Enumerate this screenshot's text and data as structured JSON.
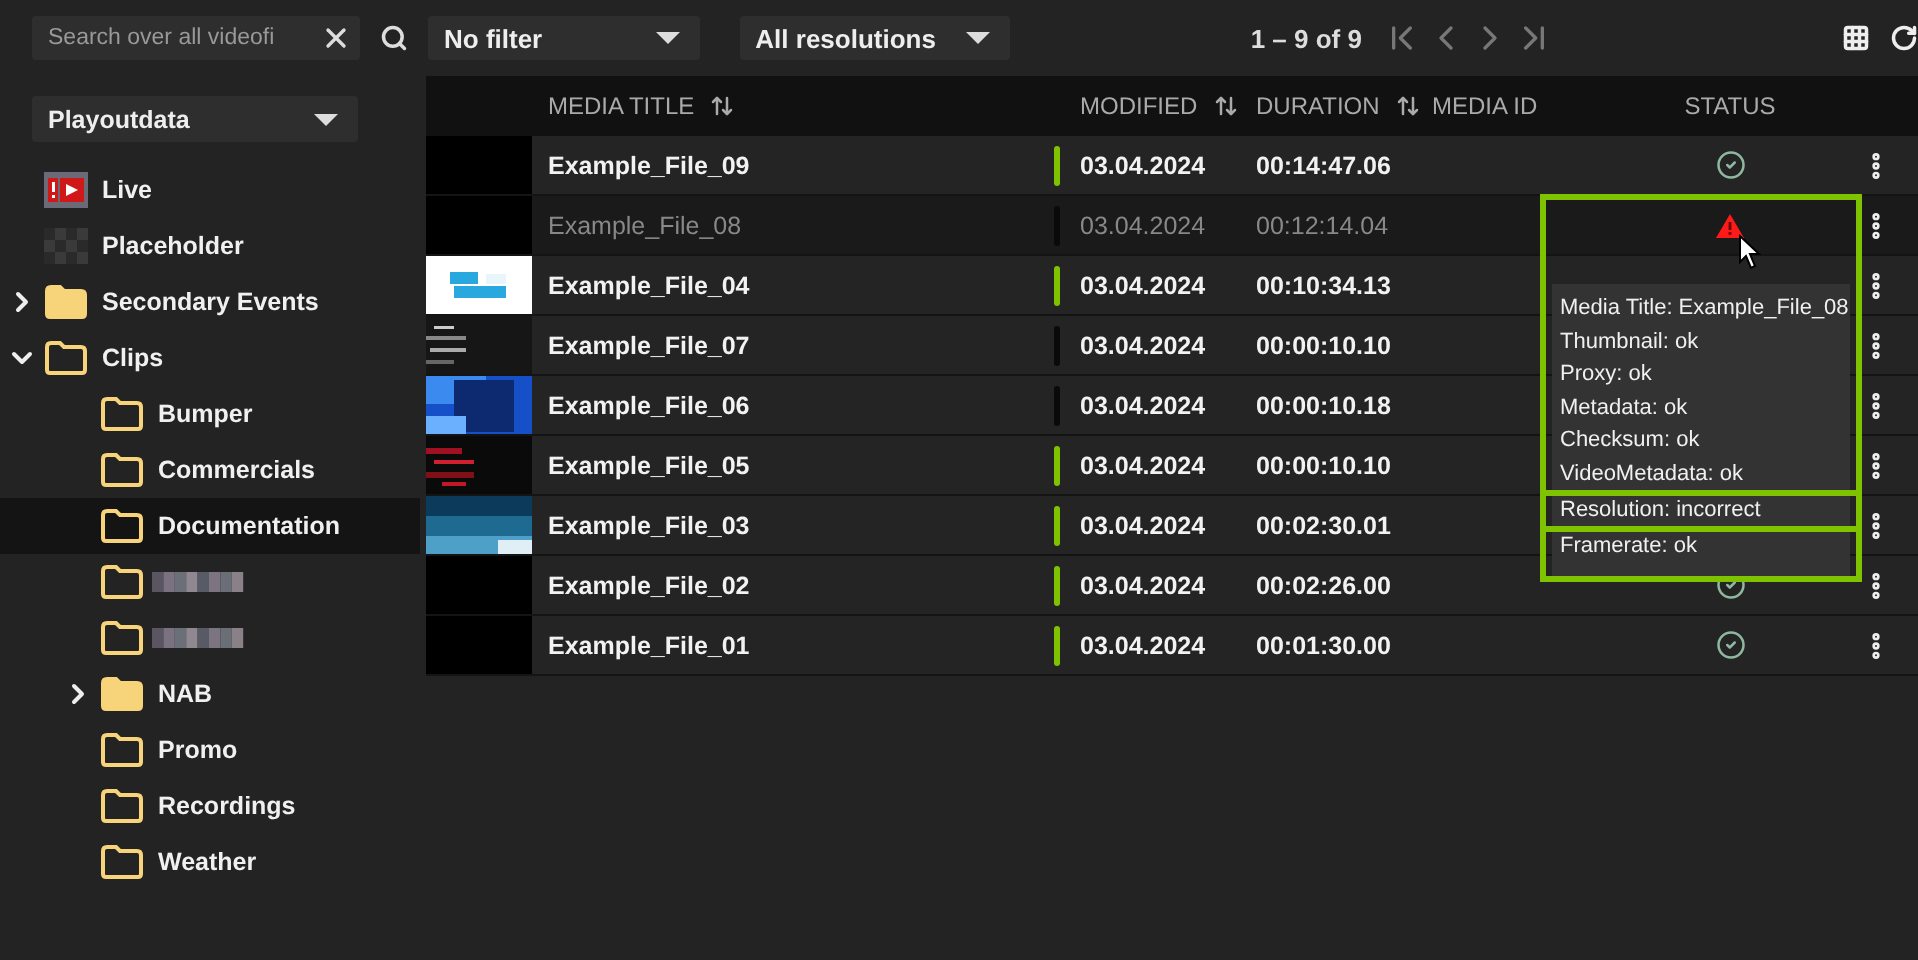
{
  "toolbar": {
    "search": {
      "placeholder": "Search over all videofi"
    },
    "filters": [
      {
        "value": "No filter"
      },
      {
        "value": "All resolutions"
      }
    ],
    "pager": {
      "range": "1 – 9 of 9"
    }
  },
  "sidebar": {
    "source": {
      "value": "Playoutdata"
    },
    "items": [
      {
        "kind": "live",
        "label": "Live",
        "selected": false
      },
      {
        "kind": "placeholder",
        "label": "Placeholder",
        "selected": false
      },
      {
        "kind": "folder",
        "label": "Secondary Events",
        "expanded": false,
        "selected": false
      },
      {
        "kind": "folder",
        "label": "Clips",
        "expanded": true,
        "selected": false,
        "children": [
          {
            "kind": "folder",
            "label": "Bumper",
            "selected": false
          },
          {
            "kind": "folder",
            "label": "Commercials",
            "selected": false
          },
          {
            "kind": "folder",
            "label": "Documentation",
            "selected": true
          },
          {
            "kind": "redacted",
            "selected": false
          },
          {
            "kind": "redacted",
            "selected": false
          },
          {
            "kind": "folder",
            "label": "NAB",
            "expanded": false,
            "selected": false
          },
          {
            "kind": "folder",
            "label": "Promo",
            "selected": false
          },
          {
            "kind": "folder",
            "label": "Recordings",
            "selected": false
          },
          {
            "kind": "folder",
            "label": "Weather",
            "selected": false
          }
        ]
      }
    ]
  },
  "table": {
    "columns": [
      {
        "label": "MEDIA TITLE",
        "sortable": true
      },
      {
        "label": "MODIFIED",
        "sortable": true
      },
      {
        "label": "DURATION",
        "sortable": true
      },
      {
        "label": "MEDIA ID",
        "sortable": false
      },
      {
        "label": "STATUS",
        "sortable": false
      }
    ],
    "rows": [
      {
        "thumbnail": {
          "kind": "blank"
        },
        "title": "Example_File_09",
        "ready": true,
        "disabled": false,
        "modified": "03.04.2024",
        "duration": "00:14:47.06",
        "status": {
          "kind": "ok"
        }
      },
      {
        "thumbnail": {
          "kind": "blank"
        },
        "title": "Example_File_08",
        "ready": false,
        "disabled": true,
        "modified": "03.04.2024",
        "duration": "00:12:14.04",
        "status": {
          "kind": "warning"
        }
      },
      {
        "title": "Example_File_04",
        "ready": true,
        "disabled": false,
        "modified": "03.04.2024",
        "duration": "00:10:34.13"
      },
      {
        "title": "Example_File_07",
        "ready": false,
        "disabled": false,
        "modified": "03.04.2024",
        "duration": "00:00:10.10"
      },
      {
        "title": "Example_File_06",
        "ready": false,
        "disabled": false,
        "modified": "03.04.2024",
        "duration": "00:00:10.18"
      },
      {
        "title": "Example_File_05",
        "ready": true,
        "disabled": false,
        "modified": "03.04.2024",
        "duration": "00:00:10.10"
      },
      {
        "title": "Example_File_03",
        "ready": true,
        "disabled": false,
        "modified": "03.04.2024",
        "duration": "00:02:30.01"
      },
      {
        "thumbnail": {
          "kind": "blank"
        },
        "title": "Example_File_02",
        "ready": true,
        "disabled": false,
        "modified": "03.04.2024",
        "duration": "00:02:26.00",
        "status": {
          "kind": "ok"
        }
      },
      {
        "thumbnail": {
          "kind": "blank"
        },
        "title": "Example_File_01",
        "ready": true,
        "disabled": false,
        "modified": "03.04.2024",
        "duration": "00:01:30.00",
        "status": {
          "kind": "ok"
        }
      }
    ]
  },
  "tooltip": {
    "groups": [
      {
        "lines": [
          "Media Title: Example_File_08",
          "Thumbnail: ok",
          "Proxy: ok",
          "Metadata: ok",
          "Checksum: ok",
          "VideoMetadata: ok"
        ]
      },
      {
        "lines": [
          "Resolution: incorrect"
        ]
      },
      {
        "lines": [
          "Framerate: ok"
        ]
      }
    ]
  }
}
